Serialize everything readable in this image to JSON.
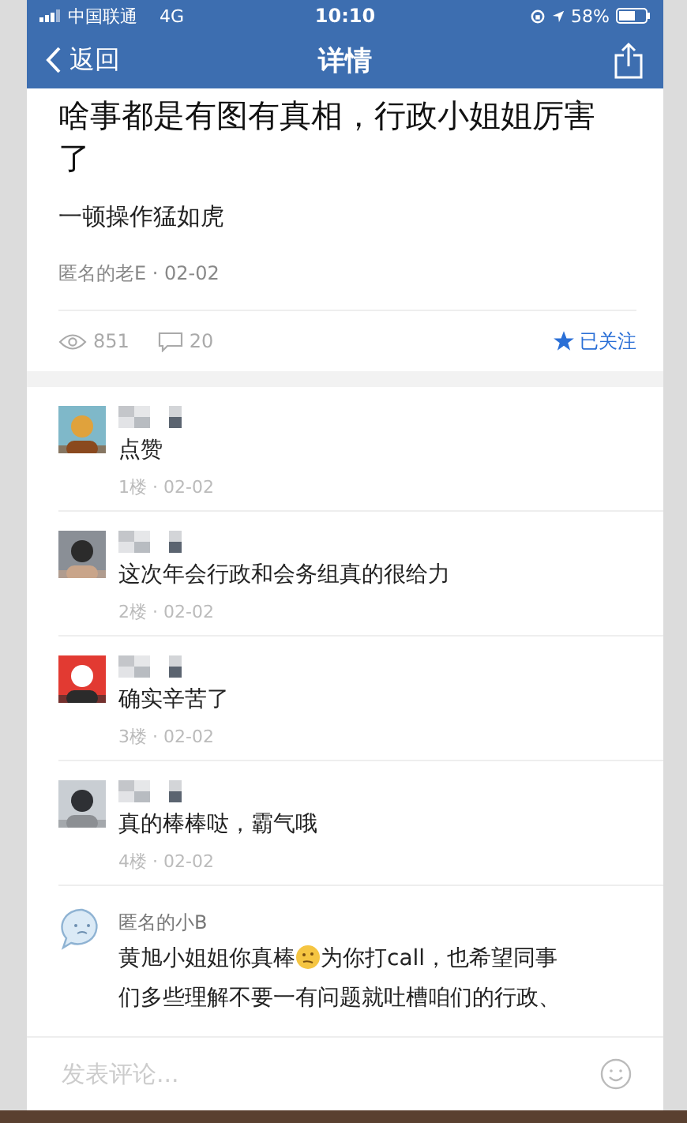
{
  "status_bar": {
    "carrier": "中国联通",
    "network": "4G",
    "time": "10:10",
    "battery": "58%"
  },
  "nav": {
    "back": "返回",
    "title": "详情"
  },
  "post": {
    "title": "啥事都是有图有真相，行政小姐姐厉害了",
    "body": "一顿操作猛如虎",
    "meta": "匿名的老E · 02-02",
    "views": "851",
    "comments": "20",
    "follow": {
      "label": "已关注",
      "selected": true
    }
  },
  "comments": [
    {
      "kind": "picture",
      "text": "点赞",
      "meta": "1楼 · 02-02"
    },
    {
      "kind": "picture",
      "text": "这次年会行政和会务组真的很给力",
      "meta": "2楼 · 02-02"
    },
    {
      "kind": "picture",
      "text": "确实辛苦了",
      "meta": "3楼 · 02-02"
    },
    {
      "kind": "picture",
      "text": "真的棒棒哒，霸气哦",
      "meta": "4楼 · 02-02"
    },
    {
      "kind": "anonymous",
      "name": "匿名的小B",
      "text": "黄旭小姐姐你真棒",
      "text_after": "为你打call，也希望同事",
      "text_line2": "们多些理解不要一有问题就吐槽咱们的行政、"
    }
  ],
  "input": {
    "placeholder": "发表评论..."
  }
}
